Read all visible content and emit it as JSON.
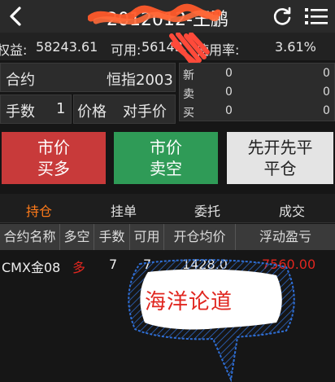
{
  "header": {
    "title": "2012012-王鹏",
    "back_icon": "back-arrow-icon",
    "refresh_icon": "refresh-icon",
    "menu_icon": "list-menu-icon"
  },
  "account": {
    "equity_label": "权益:",
    "equity_value": "58243.61",
    "available_label": "可用:",
    "available_value": "56143.",
    "usage_label": "使用率:",
    "usage_value": "3.61%"
  },
  "order_form": {
    "contract_label": "合约",
    "contract_value": "恒指2003",
    "qty_label": "手数",
    "qty_value": "1",
    "price_label": "价格",
    "price_value": "对手价"
  },
  "quote": {
    "rows": [
      {
        "label": "新",
        "left": "0",
        "right": "0"
      },
      {
        "label": "卖",
        "left": "0",
        "right": "0"
      },
      {
        "label": "买",
        "left": "0",
        "right": "0"
      }
    ]
  },
  "actions": {
    "buy_line1": "市价",
    "buy_line2": "买多",
    "sell_line1": "市价",
    "sell_line2": "卖空",
    "close_line1": "先开先平",
    "close_line2": "平仓"
  },
  "tabs": {
    "positions": "持仓",
    "pending": "挂单",
    "orders": "委托",
    "trades": "成交"
  },
  "table": {
    "headers": [
      "合约名称",
      "多空",
      "手数",
      "可用",
      "开仓均价",
      "浮动盈亏"
    ],
    "rows": [
      {
        "contract": "CMX金08",
        "direction": "多",
        "qty": "7",
        "available": "7",
        "avg_price": "1428.0",
        "pnl": "7560.00"
      }
    ]
  },
  "watermark": {
    "text": "海洋论道"
  },
  "colors": {
    "accent": "#ff7b1a",
    "buy": "#c83a3a",
    "sell": "#2f9b57",
    "profit": "#e0261f",
    "scribble": "#ff4a3a"
  }
}
